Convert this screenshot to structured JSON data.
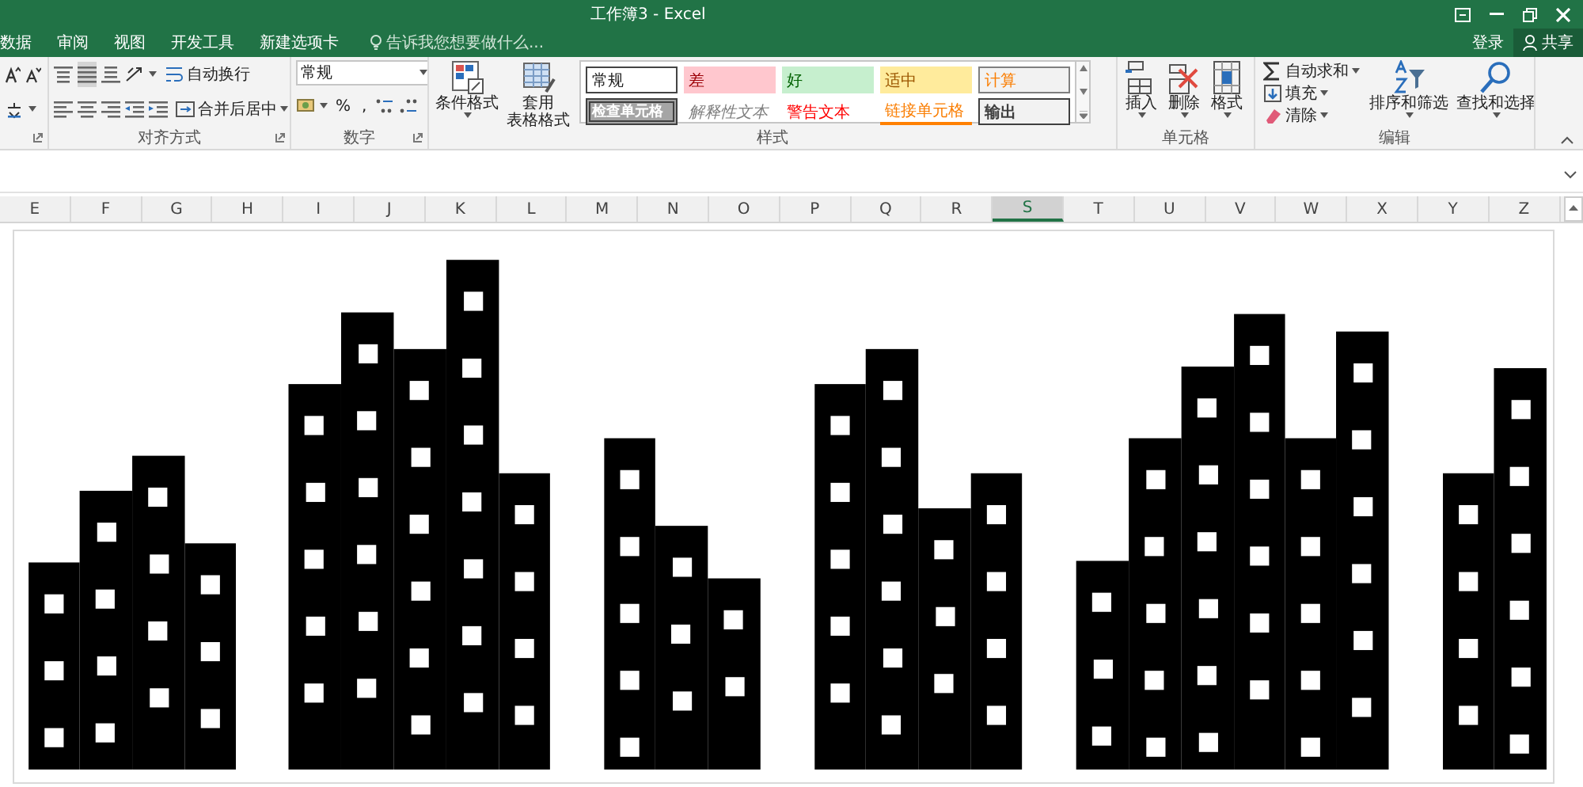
{
  "window": {
    "title": "工作簿3 - Excel"
  },
  "menu_tabs": [
    {
      "label": "数据"
    },
    {
      "label": "审阅"
    },
    {
      "label": "视图"
    },
    {
      "label": "开发工具"
    },
    {
      "label": "新建选项卡"
    }
  ],
  "tell_me": {
    "placeholder": "告诉我您想要做什么..."
  },
  "account": {
    "sign_in": "登录",
    "share": "共享"
  },
  "ribbon": {
    "groups": [
      {
        "kind": "font"
      },
      {
        "kind": "alignment",
        "label": "对齐方式",
        "wrap_text": "自动换行",
        "merge_center": "合并后居中"
      },
      {
        "kind": "number",
        "label": "数字",
        "format": "常规",
        "percent": "%",
        "comma": ","
      },
      {
        "kind": "styles",
        "label": "样式",
        "conditional_format": "条件格式",
        "table_format": [
          "套用",
          "表格格式"
        ],
        "gallery": [
          {
            "kind": "normal",
            "label": "常规"
          },
          {
            "kind": "bad",
            "label": "差"
          },
          {
            "kind": "good",
            "label": "好"
          },
          {
            "kind": "neutral",
            "label": "适中"
          },
          {
            "kind": "calculation",
            "label": "计算"
          },
          {
            "kind": "check",
            "label": "检查单元格"
          },
          {
            "kind": "explanatory",
            "label": "解释性文本"
          },
          {
            "kind": "warning",
            "label": "警告文本"
          },
          {
            "kind": "linked",
            "label": "链接单元格"
          },
          {
            "kind": "output",
            "label": "输出"
          }
        ]
      },
      {
        "kind": "cells",
        "label": "单元格",
        "buttons": [
          {
            "kind": "insert",
            "label": "插入"
          },
          {
            "kind": "delete",
            "label": "删除"
          },
          {
            "kind": "format",
            "label": "格式"
          }
        ]
      },
      {
        "kind": "editing",
        "label": "编辑",
        "small_buttons": [
          {
            "kind": "autosum",
            "label": "自动求和"
          },
          {
            "kind": "fill",
            "label": "填充"
          },
          {
            "kind": "clear",
            "label": "清除"
          }
        ],
        "big_buttons": [
          {
            "kind": "sort",
            "label": "排序和筛选"
          },
          {
            "kind": "find",
            "label": "查找和选择"
          }
        ]
      }
    ]
  },
  "columns": [
    {
      "label": "E",
      "selected": false
    },
    {
      "label": "F",
      "selected": false
    },
    {
      "label": "G",
      "selected": false
    },
    {
      "label": "H",
      "selected": false
    },
    {
      "label": "I",
      "selected": false
    },
    {
      "label": "J",
      "selected": false
    },
    {
      "label": "K",
      "selected": false
    },
    {
      "label": "L",
      "selected": false
    },
    {
      "label": "M",
      "selected": false
    },
    {
      "label": "N",
      "selected": false
    },
    {
      "label": "O",
      "selected": false
    },
    {
      "label": "P",
      "selected": false
    },
    {
      "label": "Q",
      "selected": false
    },
    {
      "label": "R",
      "selected": false
    },
    {
      "label": "S",
      "selected": true
    },
    {
      "label": "T",
      "selected": false
    },
    {
      "label": "U",
      "selected": false
    },
    {
      "label": "V",
      "selected": false
    },
    {
      "label": "W",
      "selected": false
    },
    {
      "label": "X",
      "selected": false
    },
    {
      "label": "Y",
      "selected": false
    },
    {
      "label": "Z",
      "selected": false
    }
  ]
}
